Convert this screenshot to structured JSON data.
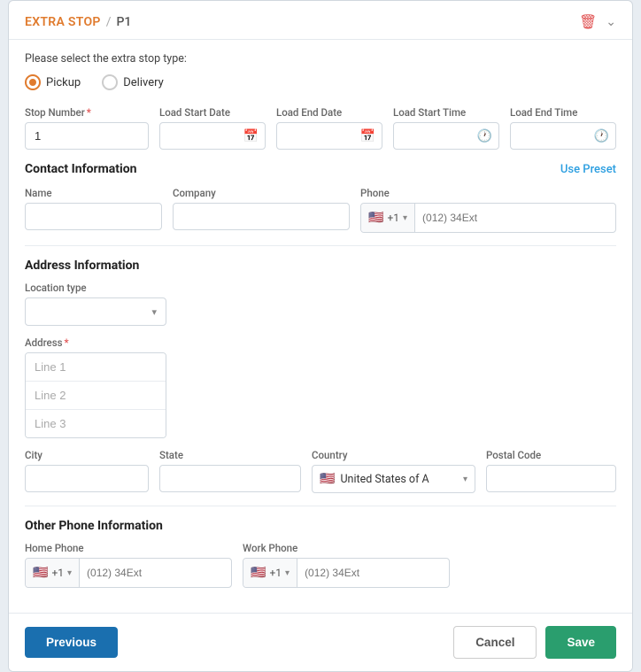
{
  "header": {
    "title": "EXTRA STOP",
    "separator": "/",
    "subtitle": "P1"
  },
  "stop_type": {
    "label": "Please select the extra stop type:",
    "options": [
      {
        "value": "pickup",
        "label": "Pickup",
        "selected": true
      },
      {
        "value": "delivery",
        "label": "Delivery",
        "selected": false
      }
    ]
  },
  "fields": {
    "stop_number": {
      "label": "Stop Number",
      "required": true,
      "value": "1"
    },
    "load_start_date": {
      "label": "Load Start Date",
      "value": ""
    },
    "load_end_date": {
      "label": "Load End Date",
      "value": ""
    },
    "load_start_time": {
      "label": "Load Start Time",
      "value": ""
    },
    "load_end_time": {
      "label": "Load End Time",
      "value": ""
    }
  },
  "contact": {
    "section_title": "Contact Information",
    "use_preset": "Use Preset",
    "name": {
      "label": "Name",
      "placeholder": ""
    },
    "company": {
      "label": "Company",
      "placeholder": ""
    },
    "phone": {
      "label": "Phone",
      "flag": "🇺🇸",
      "code": "+1",
      "placeholder": "(012) 34Ext"
    }
  },
  "address": {
    "section_title": "Address Information",
    "location_type": {
      "label": "Location type",
      "placeholder": ""
    },
    "address_label": "Address",
    "address_required": true,
    "line1_placeholder": "Line 1",
    "line2_placeholder": "Line 2",
    "line3_placeholder": "Line 3",
    "city": {
      "label": "City",
      "value": ""
    },
    "state": {
      "label": "State",
      "value": ""
    },
    "country": {
      "label": "Country",
      "flag": "🇺🇸",
      "value": "United States of A"
    },
    "postal_code": {
      "label": "Postal Code",
      "value": ""
    }
  },
  "other_phone": {
    "section_title": "Other Phone Information",
    "home_phone": {
      "label": "Home Phone",
      "flag": "🇺🇸",
      "code": "+1",
      "placeholder": "(012) 34Ext"
    },
    "work_phone": {
      "label": "Work Phone",
      "flag": "🇺🇸",
      "code": "+1",
      "placeholder": "(012) 34Ext"
    }
  },
  "footer": {
    "previous": "Previous",
    "cancel": "Cancel",
    "save": "Save"
  }
}
